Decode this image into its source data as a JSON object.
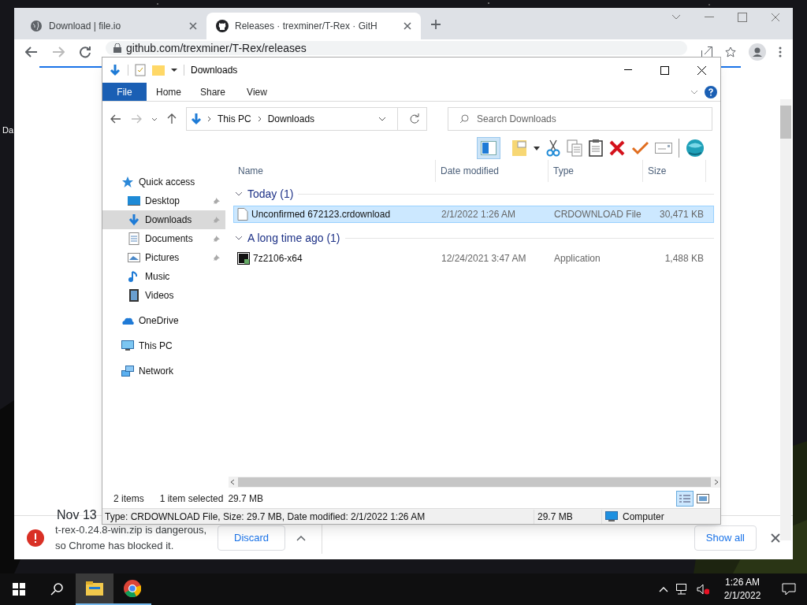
{
  "desktop": {
    "icon_label": "Da"
  },
  "browser": {
    "tabs": [
      {
        "title": "Download | file.io",
        "selected": false
      },
      {
        "title": "Releases · trexminer/T-Rex · GitH",
        "selected": true
      }
    ],
    "url": "github.com/trexminer/T-Rex/releases",
    "page_text": "Nov 13",
    "download_bar": {
      "message": [
        "t-rex-0.24.8-win.zip is dangerous,",
        "so Chrome has blocked it."
      ],
      "discard": "Discard",
      "show_all": "Show all"
    }
  },
  "explorer": {
    "title": "Downloads",
    "ribbon_tabs": [
      {
        "label": "File",
        "selected": true
      },
      {
        "label": "Home",
        "selected": false
      },
      {
        "label": "Share",
        "selected": false
      },
      {
        "label": "View",
        "selected": false
      }
    ],
    "breadcrumb": [
      "This PC",
      "Downloads"
    ],
    "search_placeholder": "Search Downloads",
    "nav": [
      {
        "label": "Quick access",
        "kind": "star",
        "selected": false,
        "pinned": false,
        "children": [
          {
            "label": "Desktop",
            "kind": "desktop",
            "selected": false,
            "pinned": true
          },
          {
            "label": "Downloads",
            "kind": "download",
            "selected": true,
            "pinned": true
          },
          {
            "label": "Documents",
            "kind": "document",
            "selected": false,
            "pinned": true
          },
          {
            "label": "Pictures",
            "kind": "pictures",
            "selected": false,
            "pinned": true
          },
          {
            "label": "Music",
            "kind": "music",
            "selected": false,
            "pinned": false
          },
          {
            "label": "Videos",
            "kind": "videos",
            "selected": false,
            "pinned": false
          }
        ]
      },
      {
        "label": "OneDrive",
        "kind": "cloud",
        "selected": false,
        "pinned": false
      },
      {
        "label": "This PC",
        "kind": "pc",
        "selected": false,
        "pinned": false
      },
      {
        "label": "Network",
        "kind": "network",
        "selected": false,
        "pinned": false
      }
    ],
    "columns": [
      "Name",
      "Date modified",
      "Type",
      "Size"
    ],
    "groups": [
      {
        "label": "Today (1)",
        "expanded": true,
        "files": [
          {
            "name": "Unconfirmed 672123.crdownload",
            "date": "2/1/2022 1:26 AM",
            "type": "CRDOWNLOAD File",
            "size": "30,471 KB",
            "kind": "blank",
            "selected": true
          }
        ]
      },
      {
        "label": "A long time ago (1)",
        "expanded": true,
        "files": [
          {
            "name": "7z2106-x64",
            "date": "12/24/2021 3:47 AM",
            "type": "Application",
            "size": "1,488 KB",
            "kind": "app",
            "selected": false
          }
        ]
      }
    ],
    "status": {
      "count": "2 items",
      "selection": "1 item selected",
      "selection_size": "29.7 MB"
    },
    "details_bar": {
      "info": "Type: CRDOWNLOAD File, Size: 29.7 MB, Date modified: 2/1/2022 1:26 AM",
      "size": "29.7 MB",
      "zone": "Computer"
    }
  },
  "taskbar": {
    "apps": [
      {
        "kind": "explorer",
        "active": true
      },
      {
        "kind": "chrome",
        "active": false
      }
    ],
    "time": "1:26 AM",
    "date": "2/1/2022"
  }
}
